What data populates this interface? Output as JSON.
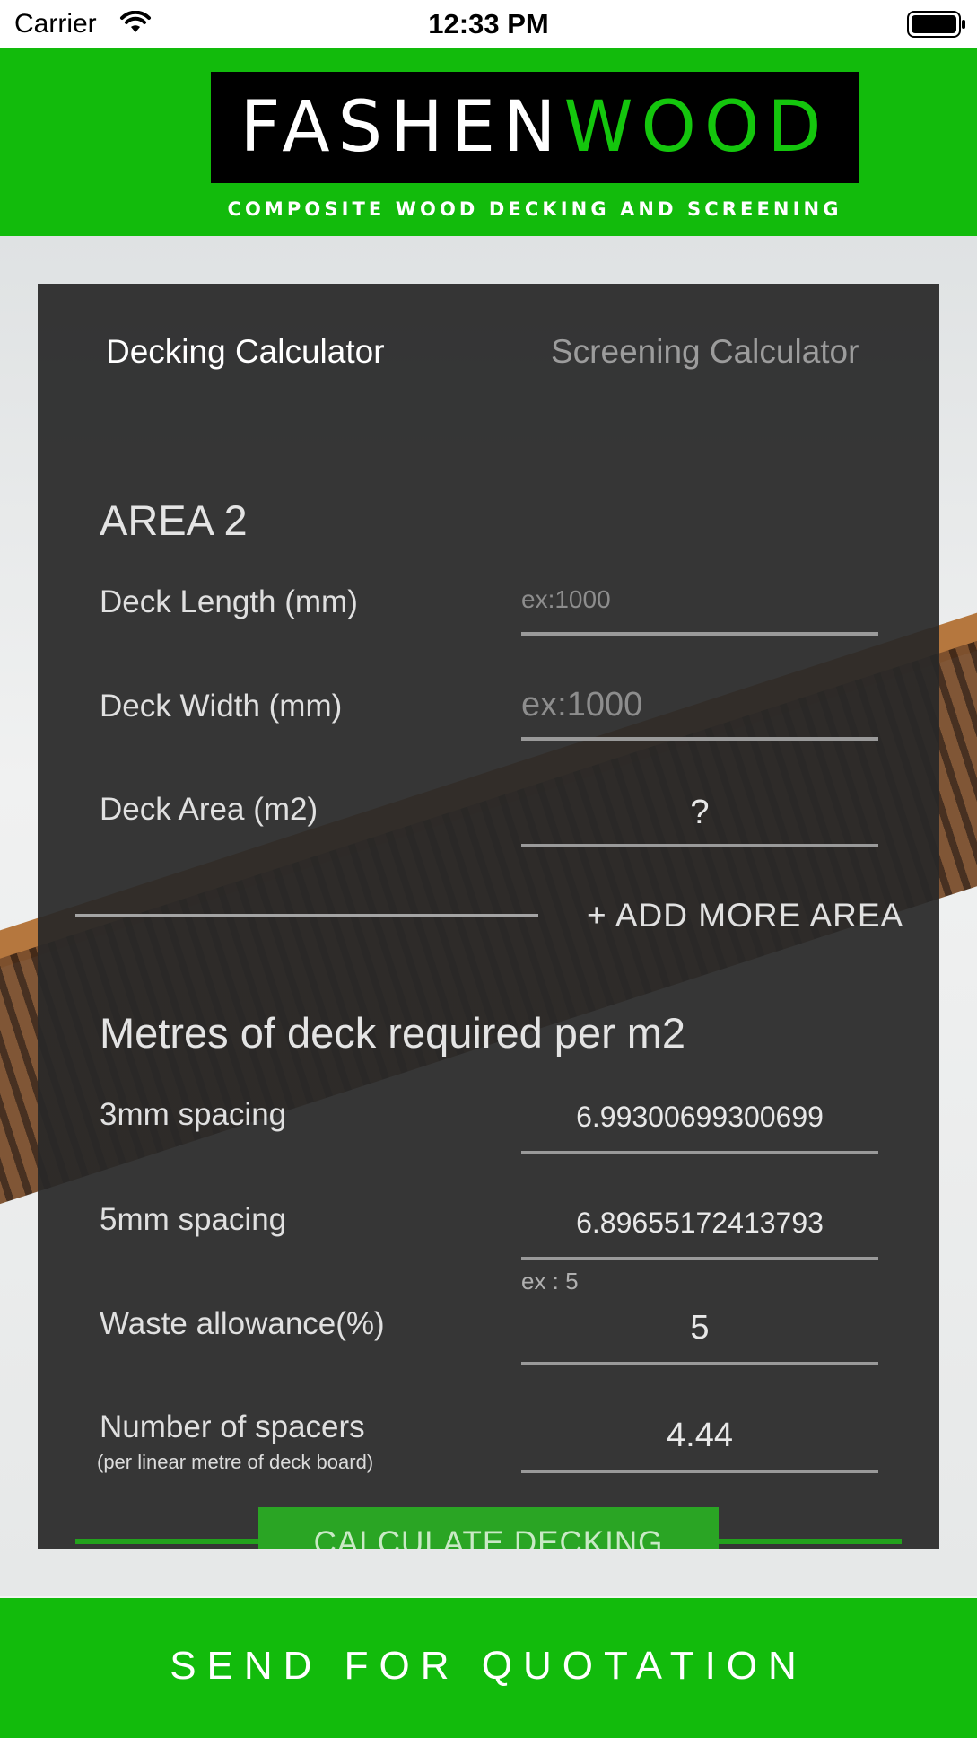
{
  "status_bar": {
    "carrier": "Carrier",
    "time": "12:33 PM"
  },
  "header": {
    "logo_part1": "FASHEN",
    "logo_part2": "WOOD",
    "tagline": "COMPOSITE WOOD DECKING AND SCREENING",
    "brand_green": "#12bb0c"
  },
  "tabs": [
    {
      "label": "Decking Calculator",
      "active": true
    },
    {
      "label": "Screening Calculator",
      "active": false
    }
  ],
  "area": {
    "title": "AREA 2",
    "length": {
      "label": "Deck Length (mm)",
      "placeholder": "ex:1000"
    },
    "width": {
      "label": "Deck Width (mm)",
      "placeholder": "ex:1000"
    },
    "area_m2": {
      "label": "Deck Area (m2)",
      "value": "?"
    },
    "add_more": "+ ADD MORE AREA"
  },
  "metres": {
    "title": "Metres of deck required per m2",
    "spacing3": {
      "label": "3mm spacing",
      "value": "6.99300699300699"
    },
    "spacing5": {
      "label": "5mm spacing",
      "value": "6.89655172413793"
    },
    "waste": {
      "label": "Waste allowance(%)",
      "hint": "ex : 5",
      "value": "5"
    },
    "spacers": {
      "label": "Number of spacers",
      "sublabel": "(per linear metre of deck board)",
      "value": "4.44"
    }
  },
  "calculate_button": "CALCULATE DECKING",
  "footer": {
    "quote_button": "SEND FOR QUOTATION"
  }
}
